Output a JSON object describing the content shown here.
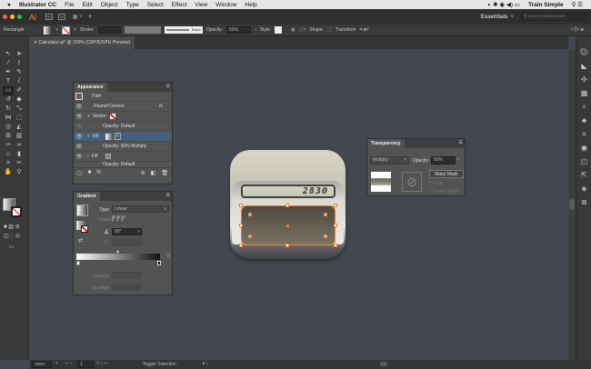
{
  "menubar": {
    "app": "Illustrator CC",
    "items": [
      "File",
      "Edit",
      "Object",
      "Type",
      "Select",
      "Effect",
      "View",
      "Window",
      "Help"
    ],
    "user": "Train Simple"
  },
  "appbar": {
    "logo": "Ai",
    "br": "Br",
    "st": "St",
    "workspace": "Essentials",
    "search_placeholder": "Search Adobe Stock"
  },
  "control": {
    "selection": "Rectangle",
    "stroke_label": "Stroke:",
    "brush": "Basic",
    "opacity_label": "Opacity:",
    "opacity": "50%",
    "style_label": "Style:",
    "shape_label": "Shape:",
    "transform_label": "Transform"
  },
  "document_tab": {
    "title": "Calculator.ai* @ 100% (CMYK/GPU Preview)"
  },
  "appearance": {
    "title": "Appearance",
    "rows": [
      {
        "label": "Path"
      },
      {
        "label": "Round Corners",
        "fx": "fx"
      },
      {
        "label": "Stroke:"
      },
      {
        "label": "Opacity: Default"
      },
      {
        "label": "Fill:"
      },
      {
        "label": "Opacity: 50% Multiply"
      },
      {
        "label": "Fill:"
      },
      {
        "label": "Opacity: Default"
      }
    ],
    "fx": "fx."
  },
  "gradient": {
    "title": "Gradient",
    "type_label": "Type:",
    "type": "Linear",
    "stroke_label": "Stroke:",
    "angle": "90°",
    "opacity_label": "Opacity:",
    "location_label": "Location:"
  },
  "transparency": {
    "title": "Transparency",
    "blend": "Multiply",
    "opacity_label": "Opacity:",
    "opacity": "50%",
    "make_mask": "Make Mask",
    "clip": "Clip",
    "invert": "Invert Mask"
  },
  "calculator": {
    "display": "2830"
  },
  "status": {
    "zoom": "100%",
    "artboard": "1",
    "tool": "Toggle Selection"
  },
  "colors": {
    "canvas": "#434850",
    "selection": "#f07a2a"
  }
}
